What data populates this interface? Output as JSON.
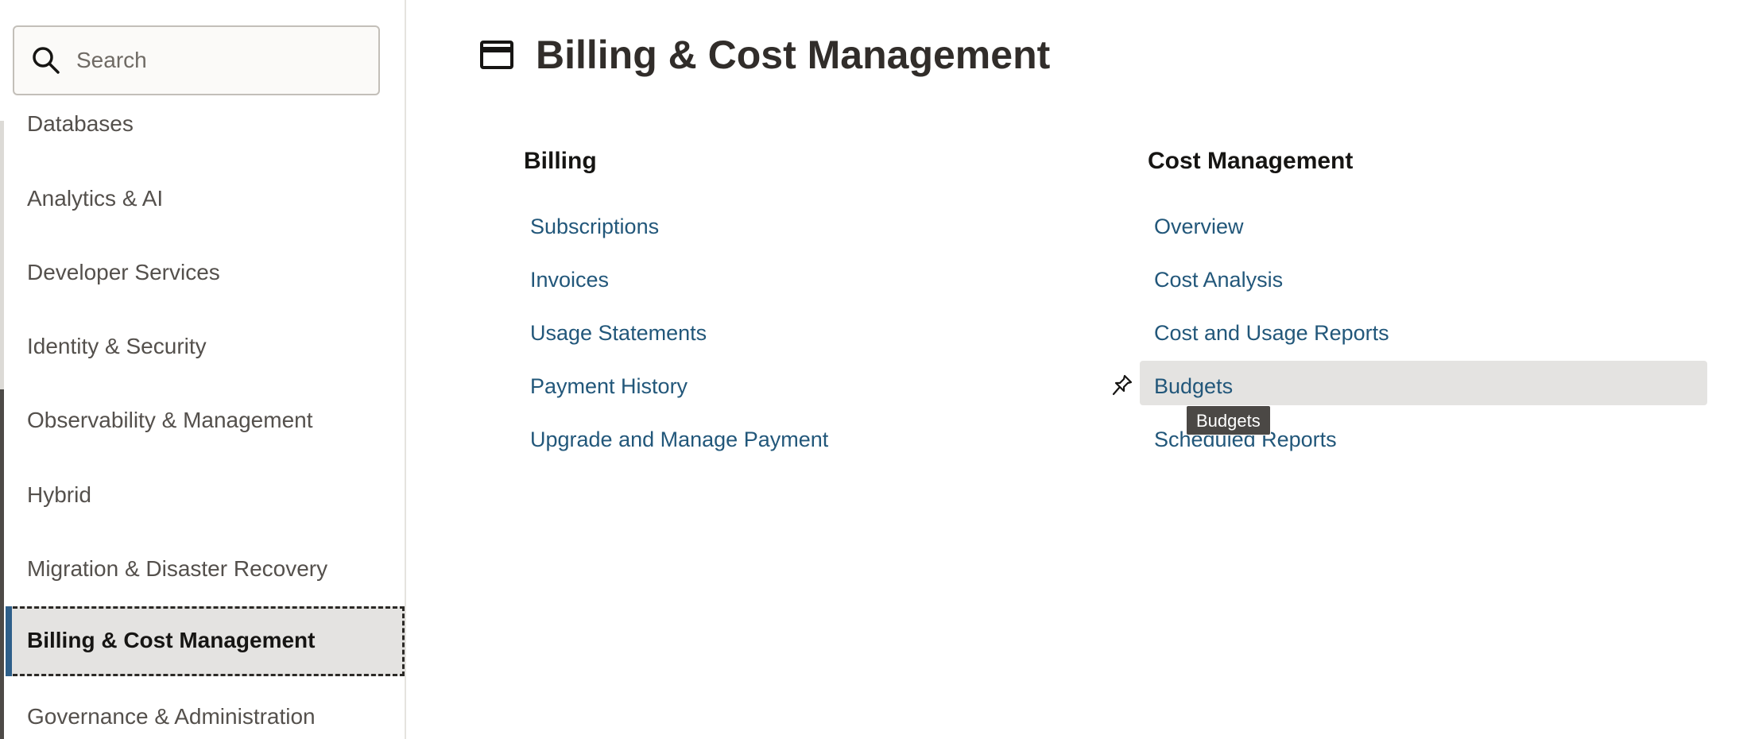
{
  "search": {
    "placeholder": "Search",
    "icon": "search-icon"
  },
  "sidebar": {
    "items": [
      {
        "label": "Databases"
      },
      {
        "label": "Analytics & AI"
      },
      {
        "label": "Developer Services"
      },
      {
        "label": "Identity & Security"
      },
      {
        "label": "Observability & Management"
      },
      {
        "label": "Hybrid"
      },
      {
        "label": "Migration & Disaster Recovery"
      },
      {
        "label": "Billing & Cost Management",
        "active": true
      },
      {
        "label": "Governance & Administration"
      }
    ],
    "accent_color": "#2e5f8a"
  },
  "main": {
    "title": "Billing & Cost Management",
    "title_icon": "credit-card-icon",
    "sections": [
      {
        "heading": "Billing",
        "links": [
          {
            "label": "Subscriptions"
          },
          {
            "label": "Invoices"
          },
          {
            "label": "Usage Statements"
          },
          {
            "label": "Payment History"
          },
          {
            "label": "Upgrade and Manage Payment"
          }
        ]
      },
      {
        "heading": "Cost Management",
        "links": [
          {
            "label": "Overview"
          },
          {
            "label": "Cost Analysis"
          },
          {
            "label": "Cost and Usage Reports"
          },
          {
            "label": "Budgets",
            "hovered": true
          },
          {
            "label": "Scheduled Reports"
          }
        ]
      }
    ],
    "link_color": "#22577a",
    "hover_pin_icon": "pin-icon",
    "tooltip": "Budgets"
  }
}
